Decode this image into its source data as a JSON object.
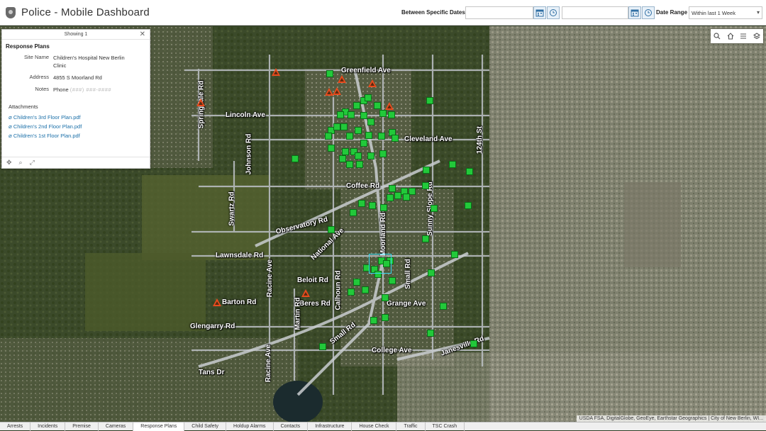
{
  "app": {
    "title": "Police - Mobile Dashboard",
    "badge_icon": "police-badge-icon"
  },
  "filters": {
    "between_label": "Between Specific Dates",
    "start_date": "",
    "end_date": "",
    "range_label": "Date Range",
    "range_value": "Within last 1 Week"
  },
  "popup": {
    "showing": "Showing 1",
    "title": "Response Plans",
    "fields": [
      {
        "label": "Site Name",
        "value": "Children's Hospital New Berlin Clinic"
      },
      {
        "label": "Address",
        "value": "4855 S Moorland Rd"
      },
      {
        "label": "Notes",
        "value": "Phone",
        "hidden": "(###) ###-####"
      }
    ],
    "attachments_title": "Attachments",
    "attachments": [
      "Children's 3rd Floor Plan.pdf",
      "Children's 2nd Floor Plan.pdf",
      "Children's 1st Floor Plan.pdf"
    ]
  },
  "map": {
    "road_labels": [
      "Greenfield Ave",
      "Lincoln Ave",
      "Cleveland Ave",
      "Coffee Rd",
      "Observatory Rd",
      "National Ave",
      "Moorland Rd",
      "Sunny Slope Rd",
      "124th St",
      "Lawnsdale Rd",
      "Beloit Rd",
      "Calhoun Rd",
      "Small Rd",
      "Grange Ave",
      "Barton Rd",
      "Beres Rd",
      "Martin Rd",
      "Racine Ave",
      "Glengarry Rd",
      "Small Rd",
      "College Ave",
      "Janesville Rd",
      "Tans Dr",
      "Racine Ave",
      "Swartz Rd",
      "Johnson Rd",
      "Springdale Rd"
    ],
    "attribution": "USDA FSA, DigitalGlobe, GeoEye, Earthstar Geographics | City of New Berlin, WI...",
    "colors": {
      "incident": "#22c93a",
      "alarm": "#e84b1d",
      "selection": "#37d8f0"
    }
  },
  "tabs": [
    "Arrests",
    "Incidents",
    "Premise",
    "Cameras",
    "Response Plans",
    "Child Safety",
    "Holdup Alarms",
    "Contacts",
    "Infrastructure",
    "House Check",
    "Traffic",
    "TSC Crash"
  ],
  "active_tab": "Response Plans"
}
